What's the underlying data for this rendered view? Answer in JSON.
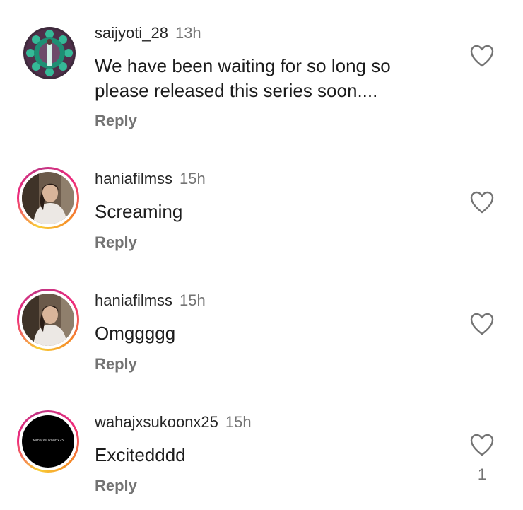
{
  "comments": [
    {
      "username": "saijyoti_28",
      "time": "13h",
      "text_lines": [
        "We have been waiting for so long so",
        "please released this series soon...."
      ],
      "reply_label": "Reply",
      "like_count": ""
    },
    {
      "username": "haniafilmss",
      "time": "15h",
      "text_lines": [
        "Screaming"
      ],
      "reply_label": "Reply",
      "like_count": ""
    },
    {
      "username": "haniafilmss",
      "time": "15h",
      "text_lines": [
        "Omggggg"
      ],
      "reply_label": "Reply",
      "like_count": ""
    },
    {
      "username": "wahajxsukoonx25",
      "time": "15h",
      "text_lines": [
        "Excitedddd"
      ],
      "reply_label": "Reply",
      "like_count": "1",
      "avatar_text": "wahajxsukoonx25"
    }
  ],
  "icons": {
    "like": "heart-outline-icon"
  },
  "colors": {
    "secondary_text": "#737373",
    "primary_text": "#262626"
  }
}
